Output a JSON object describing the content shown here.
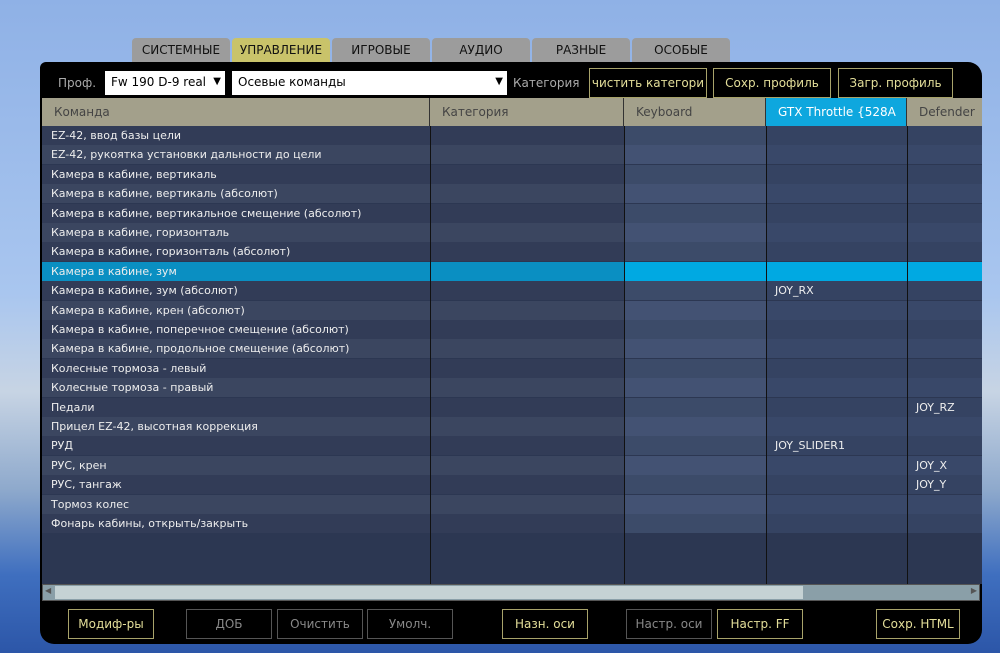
{
  "tabs": [
    "СИСТЕМНЫЕ",
    "УПРАВЛЕНИЕ",
    "ИГРОВЫЕ",
    "АУДИО",
    "РАЗНЫЕ",
    "ОСОБЫЕ"
  ],
  "active_tab": 1,
  "toolbar": {
    "profile_label": "Проф.",
    "profile_value": "Fw 190 D-9 real",
    "category_select": "Осевые команды",
    "category_label": "Категория",
    "clear_category": "чистить категори",
    "save_profile": "Сохр. профиль",
    "load_profile": "Загр. профиль"
  },
  "columns": [
    "Команда",
    "Категория",
    "Keyboard",
    "GTX Throttle  {528A",
    "Defender"
  ],
  "rows": [
    {
      "cmd": "EZ-42, ввод базы цели",
      "gtx": "",
      "def": ""
    },
    {
      "cmd": "EZ-42, рукоятка установки дальности до цели",
      "gtx": "",
      "def": ""
    },
    {
      "cmd": "Камера в кабине, вертикаль",
      "gtx": "",
      "def": ""
    },
    {
      "cmd": "Камера в кабине, вертикаль (абсолют)",
      "gtx": "",
      "def": ""
    },
    {
      "cmd": "Камера в кабине, вертикальное смещение (абсолют)",
      "gtx": "",
      "def": ""
    },
    {
      "cmd": "Камера в кабине, горизонталь",
      "gtx": "",
      "def": ""
    },
    {
      "cmd": "Камера в кабине, горизонталь (абсолют)",
      "gtx": "",
      "def": ""
    },
    {
      "cmd": "Камера в кабине, зум",
      "gtx": "",
      "def": ""
    },
    {
      "cmd": "Камера в кабине, зум (абсолют)",
      "gtx": "JOY_RX",
      "def": ""
    },
    {
      "cmd": "Камера в кабине, крен (абсолют)",
      "gtx": "",
      "def": ""
    },
    {
      "cmd": "Камера в кабине, поперечное смещение (абсолют)",
      "gtx": "",
      "def": ""
    },
    {
      "cmd": "Камера в кабине, продольное смещение (абсолют)",
      "gtx": "",
      "def": ""
    },
    {
      "cmd": "Колесные тормоза - левый",
      "gtx": "",
      "def": ""
    },
    {
      "cmd": "Колесные тормоза - правый",
      "gtx": "",
      "def": ""
    },
    {
      "cmd": "Педали",
      "gtx": "",
      "def": "JOY_RZ"
    },
    {
      "cmd": "Прицел EZ-42, высотная коррекция",
      "gtx": "",
      "def": ""
    },
    {
      "cmd": "РУД",
      "gtx": "JOY_SLIDER1",
      "def": ""
    },
    {
      "cmd": "РУС, крен",
      "gtx": "",
      "def": "JOY_X"
    },
    {
      "cmd": "РУС, тангаж",
      "gtx": "",
      "def": "JOY_Y"
    },
    {
      "cmd": "Тормоз колес",
      "gtx": "",
      "def": ""
    },
    {
      "cmd": "Фонарь кабины, открыть/закрыть",
      "gtx": "",
      "def": ""
    }
  ],
  "selected_row": 7,
  "bottom": {
    "modifiers": "Модиф-ры",
    "add": "ДОБ",
    "clear": "Очистить",
    "default": "Умолч.",
    "assign_axis": "Назн. оси",
    "axis_tune": "Настр. оси",
    "ff_tune": "Настр. FF",
    "save_html": "Сохр. HTML"
  },
  "colors": {
    "accent": "#0ea7de",
    "tab_active": "#c9c36a",
    "button_border": "#a8a36a"
  }
}
